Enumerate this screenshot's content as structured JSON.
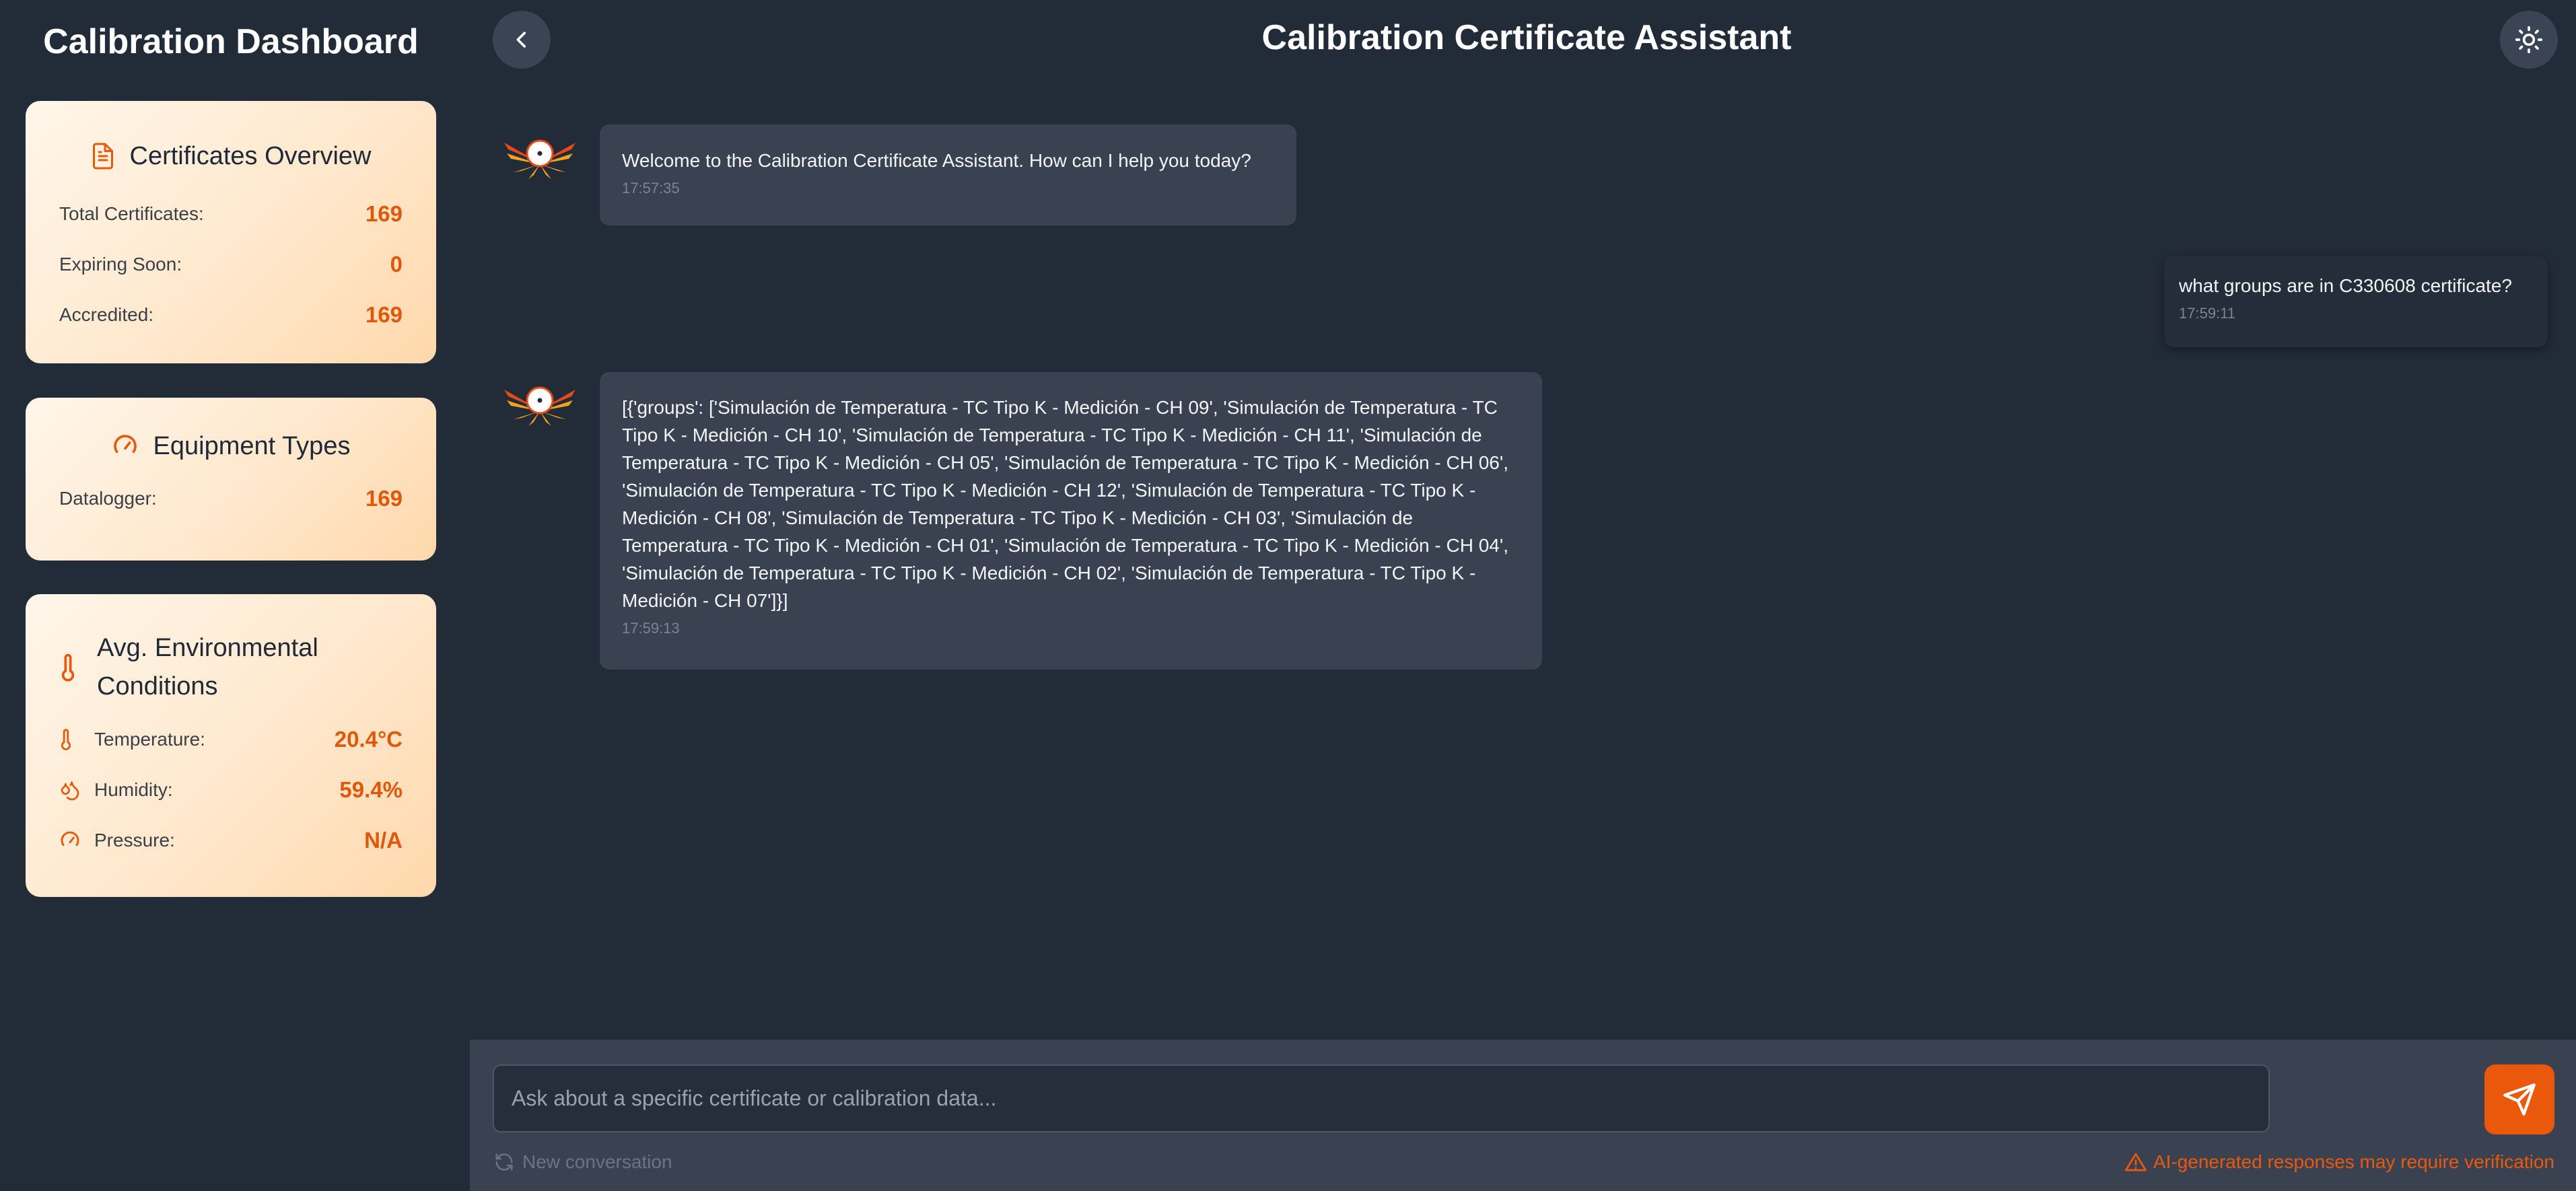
{
  "sidebar": {
    "title": "Calibration Dashboard",
    "certificates": {
      "heading": "Certificates Overview",
      "icon": "document-icon",
      "rows": [
        {
          "label": "Total Certificates:",
          "value": "169"
        },
        {
          "label": "Expiring Soon:",
          "value": "0"
        },
        {
          "label": "Accredited:",
          "value": "169"
        }
      ]
    },
    "equipment": {
      "heading": "Equipment Types",
      "icon": "gauge-icon",
      "rows": [
        {
          "label": "Datalogger:",
          "value": "169"
        }
      ]
    },
    "environment": {
      "heading": "Avg. Environmental Conditions",
      "icon": "thermometer-icon",
      "rows": [
        {
          "label": "Temperature:",
          "value": "20.4°C",
          "icon": "thermometer-icon"
        },
        {
          "label": "Humidity:",
          "value": "59.4%",
          "icon": "droplets-icon"
        },
        {
          "label": "Pressure:",
          "value": "N/A",
          "icon": "gauge-icon"
        }
      ]
    }
  },
  "header": {
    "title": "Calibration Certificate Assistant",
    "back_icon": "chevron-left-icon",
    "theme_icon": "sun-icon"
  },
  "messages": [
    {
      "role": "assistant",
      "text": "Welcome to the Calibration Certificate Assistant. How can I help you today?",
      "time": "17:57:35"
    },
    {
      "role": "user",
      "text": "what groups are in C330608 certificate?",
      "time": "17:59:11"
    },
    {
      "role": "assistant",
      "text": "[{'groups': ['Simulación de Temperatura - TC Tipo K - Medición - CH 09', 'Simulación de Temperatura - TC Tipo K - Medición - CH 10', 'Simulación de Temperatura - TC Tipo K - Medición - CH 11', 'Simulación de Temperatura - TC Tipo K - Medición - CH 05', 'Simulación de Temperatura - TC Tipo K - Medición - CH 06', 'Simulación de Temperatura - TC Tipo K - Medición - CH 12', 'Simulación de Temperatura - TC Tipo K - Medición - CH 08', 'Simulación de Temperatura - TC Tipo K - Medición - CH 03', 'Simulación de Temperatura - TC Tipo K - Medición - CH 01', 'Simulación de Temperatura - TC Tipo K - Medición - CH 04', 'Simulación de Temperatura - TC Tipo K - Medición - CH 02', 'Simulación de Temperatura - TC Tipo K - Medición - CH 07']}]",
      "time": "17:59:13"
    }
  ],
  "composer": {
    "placeholder": "Ask about a specific certificate or calibration data...",
    "new_conversation": "New conversation",
    "warning": "AI-generated responses may require verification"
  },
  "colors": {
    "accent": "#ea580c",
    "background": "#222b38",
    "card_gradient_start": "#fff6ea",
    "card_gradient_end": "#ffd8ac"
  }
}
